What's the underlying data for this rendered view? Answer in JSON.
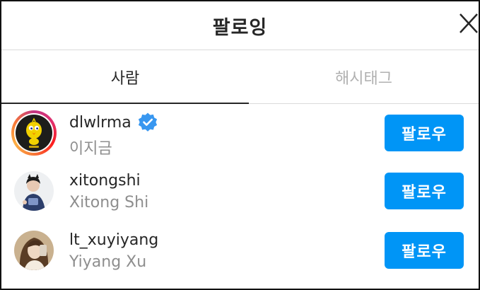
{
  "header": {
    "title": "팔로잉"
  },
  "tabs": [
    {
      "label": "사람",
      "active": true
    },
    {
      "label": "해시태그",
      "active": false
    }
  ],
  "users": [
    {
      "username": "dlwlrma",
      "full_name": "이지금",
      "verified": true,
      "has_story": true,
      "follow_label": "팔로우"
    },
    {
      "username": "xitongshi",
      "full_name": "Xitong Shi",
      "verified": false,
      "has_story": false,
      "follow_label": "팔로우"
    },
    {
      "username": "lt_xuyiyang",
      "full_name": "Yiyang Xu",
      "verified": false,
      "has_story": false,
      "follow_label": "팔로우"
    }
  ],
  "colors": {
    "follow_button": "#0095f6",
    "verified_badge": "#3897f0",
    "secondary_text": "#8e8e8e",
    "inactive_tab": "#b0b0b0"
  },
  "icons": {
    "close": "close-icon",
    "verified": "verified-badge-icon"
  }
}
